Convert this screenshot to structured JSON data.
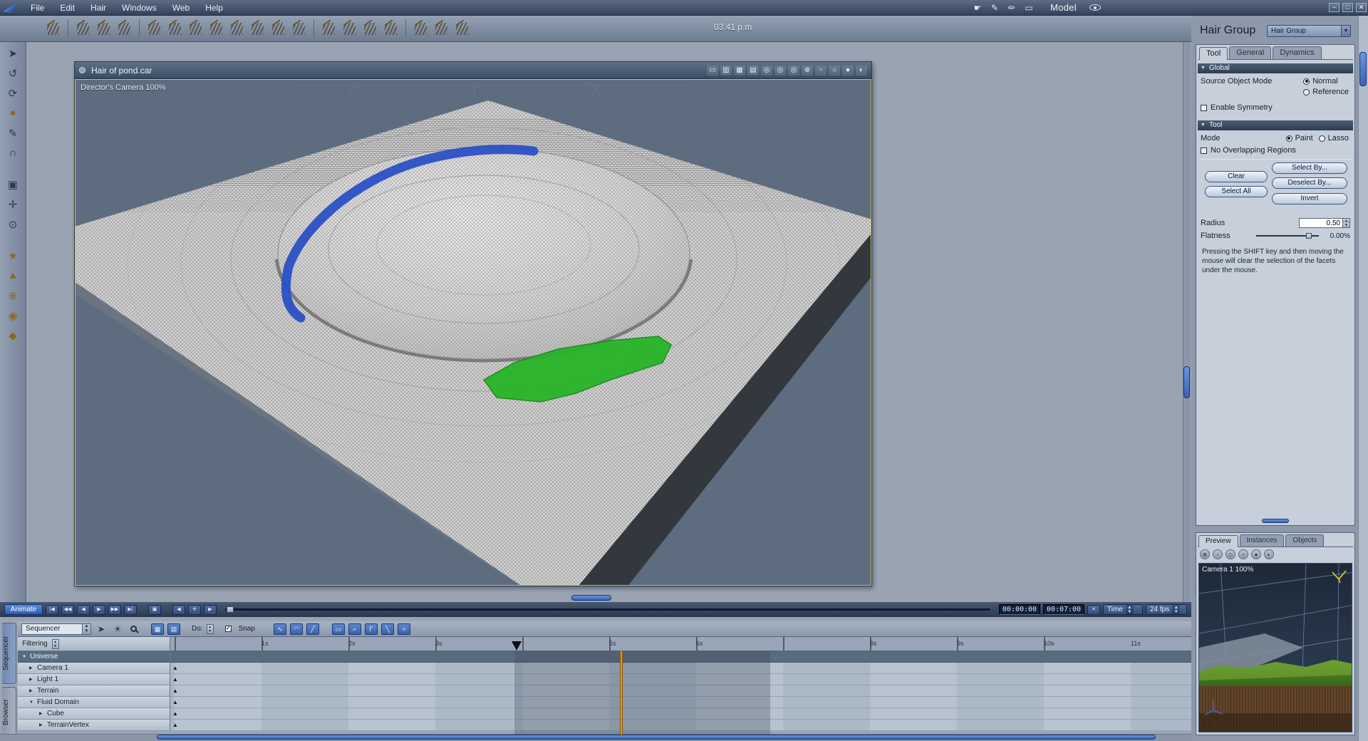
{
  "app": {
    "menu_items": [
      "File",
      "Edit",
      "Hair",
      "Windows",
      "Web",
      "Help"
    ],
    "mode_label": "Model",
    "clock": "03:41 p.m"
  },
  "viewport": {
    "title": "Hair of pond.car",
    "camera_label": "Director's Camera 100%"
  },
  "right_panel": {
    "hair_group_label": "Hair Group",
    "hair_group_value": "Hair Group",
    "tabs": [
      "Tool",
      "General",
      "Dynamics"
    ],
    "global": {
      "title": "Global",
      "source_mode_label": "Source Object Mode",
      "normal": "Normal",
      "reference": "Reference",
      "symmetry": "Enable Symmetry"
    },
    "tool": {
      "title": "Tool",
      "mode_label": "Mode",
      "paint": "Paint",
      "lasso": "Lasso",
      "no_overlap": "No Overlapping Regions",
      "clear": "Clear",
      "select_all": "Select All",
      "select_by": "Select By...",
      "deselect_by": "Deselect By...",
      "invert": "Invert",
      "radius_label": "Radius",
      "radius_value": "0.50",
      "flatness_label": "Flatness",
      "flatness_value": "0.00%",
      "help": "Pressing the SHIFT key and then moving the mouse will clear the selection of the facets under the mouse."
    }
  },
  "preview": {
    "tabs": [
      "Preview",
      "Instances",
      "Objects"
    ],
    "camera_label": "Camera 1 100%"
  },
  "transport": {
    "animate": "Animate",
    "buttons": [
      "|◀",
      "◀◀",
      "◀",
      "▶",
      "▶▶",
      "▶|"
    ],
    "aux_buttons": [
      "▣",
      "◀",
      "✛",
      "▶"
    ],
    "current_time": "00:00:00",
    "end_time": "00:07:00",
    "time_mode": "Time",
    "fps": "24 fps"
  },
  "sequencer": {
    "vertical_tabs": [
      "Sequencer",
      "Browser"
    ],
    "dropdown": "Sequencer",
    "do_label": "Do:",
    "snap_label": "Snap",
    "filtering_label": "Filtering",
    "ruler_labels": [
      "1s",
      "2s",
      "3s",
      "5s",
      "6s",
      "8s",
      "9s",
      "10s",
      "11s"
    ],
    "tracks": [
      {
        "name": "Universe",
        "arrow": "▼"
      },
      {
        "name": "Camera 1",
        "arrow": "▶"
      },
      {
        "name": "Light 1",
        "arrow": "▶"
      },
      {
        "name": "Terrain",
        "arrow": "▶"
      },
      {
        "name": "Fluid Domain",
        "arrow": "▼"
      },
      {
        "name": "Cube",
        "arrow": "▶"
      },
      {
        "name": "TerrainVertex",
        "arrow": "▶"
      }
    ]
  },
  "icon_glyphs": {
    "left_tools": [
      "➤",
      "↺",
      "⟳",
      "●",
      "✎",
      "∩",
      "▣",
      "✛",
      "⊙",
      "★",
      "▲",
      "⊕",
      "◉",
      "◆"
    ],
    "viewport_bar": [
      "▭",
      "▥",
      "▦",
      "▤",
      "◎",
      "◎",
      "◎",
      "⊕",
      "▫",
      "○",
      "●",
      "◐"
    ],
    "preview_bar": [
      "⊕",
      "▫",
      "◇",
      "○",
      "●",
      "◐"
    ],
    "interp": [
      "∿",
      "◠",
      "╱",
      "▭",
      "⌐",
      "Γ",
      "╲",
      "≈"
    ]
  },
  "colors": {
    "accent_blue": "#4a7ac8",
    "selection_green": "#28b428",
    "selection_blue": "#2a50c4",
    "marker_orange": "#e2951e",
    "viewport_border_yellow": "#d6c63e"
  }
}
